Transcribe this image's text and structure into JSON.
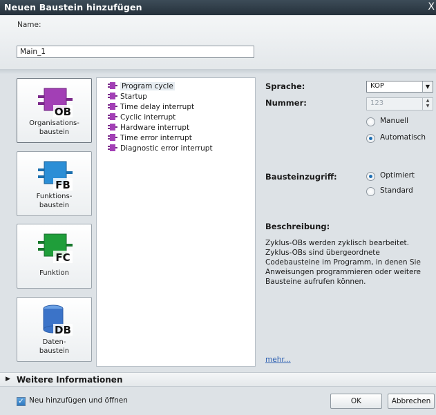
{
  "dialog": {
    "title": "Neuen Baustein hinzufügen",
    "close_glyph": "X"
  },
  "name": {
    "label": "Name:",
    "value": "Main_1"
  },
  "block_types": [
    {
      "label": "Organisations-\nbaustein",
      "tag": "OB",
      "color": "#a23fb5"
    },
    {
      "label": "Funktions-\nbaustein",
      "tag": "FB",
      "color": "#2b8ed6"
    },
    {
      "label": "Funktion",
      "tag": "FC",
      "color": "#1f9e3a"
    },
    {
      "label": "Daten-\nbaustein",
      "tag": "DB",
      "color": "#3b73c8"
    }
  ],
  "ob_list": [
    "Program cycle",
    "Startup",
    "Time delay interrupt",
    "Cyclic interrupt",
    "Hardware interrupt",
    "Time error interrupt",
    "Diagnostic error interrupt"
  ],
  "properties": {
    "sprache_label": "Sprache:",
    "sprache_value": "KOP",
    "nummer_label": "Nummer:",
    "nummer_value": "123",
    "manuell": "Manuell",
    "automatisch": "Automatisch",
    "zugriff_label": "Bausteinzugriff:",
    "optimiert": "Optimiert",
    "standard": "Standard",
    "beschreibung_label": "Beschreibung:",
    "beschreibung_text": "Zyklus-OBs werden zyklisch bearbeitet. Zyklus-OBs sind übergeordnete Codebausteine im Programm, in denen Sie Anweisungen programmieren oder weitere Bausteine aufrufen können.",
    "more_link": "mehr..."
  },
  "info_bar": {
    "label": "Weitere Informationen"
  },
  "footer": {
    "checkbox_label": "Neu hinzufügen und öffnen",
    "ok": "OK",
    "cancel": "Abbrechen"
  },
  "colors": {
    "accent": "#1f6fb3",
    "ob_icon": "#a23fb5"
  }
}
